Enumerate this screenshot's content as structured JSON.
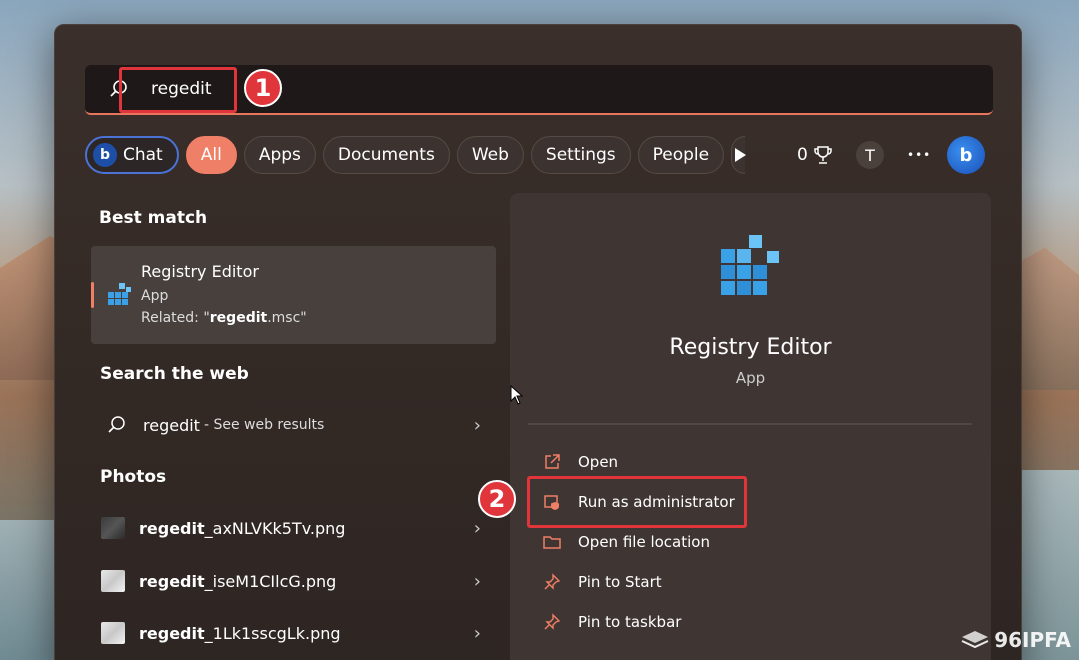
{
  "search": {
    "query": "regedit"
  },
  "callouts": {
    "one": "1",
    "two": "2"
  },
  "filters": {
    "chat": "Chat",
    "chat_logo": "b",
    "tabs": [
      "All",
      "Apps",
      "Documents",
      "Web",
      "Settings",
      "People"
    ]
  },
  "toolbar": {
    "points": "0",
    "avatar": "T",
    "more": "•••",
    "bing": "b"
  },
  "best_match": {
    "heading": "Best match",
    "title": "Registry Editor",
    "type": "App",
    "related_prefix": "Related: \"",
    "related_bold": "regedit",
    "related_suffix": ".msc\""
  },
  "web": {
    "heading": "Search the web",
    "query": "regedit",
    "suffix": " - See web results"
  },
  "photos": {
    "heading": "Photos",
    "items": [
      {
        "bold": "regedit",
        "rest": "_axNLVKk5Tv.png",
        "thumb": "dark"
      },
      {
        "bold": "regedit",
        "rest": "_iseM1CIlcG.png",
        "thumb": "light"
      },
      {
        "bold": "regedit",
        "rest": "_1Lk1sscgLk.png",
        "thumb": "light"
      }
    ]
  },
  "details": {
    "title": "Registry Editor",
    "type": "App",
    "actions": [
      {
        "label": "Open",
        "icon": "open-external-icon"
      },
      {
        "label": "Run as administrator",
        "icon": "shield-admin-icon"
      },
      {
        "label": "Open file location",
        "icon": "folder-icon"
      },
      {
        "label": "Pin to Start",
        "icon": "pin-icon"
      },
      {
        "label": "Pin to taskbar",
        "icon": "pin-icon"
      }
    ]
  },
  "watermark": "96IPFA"
}
